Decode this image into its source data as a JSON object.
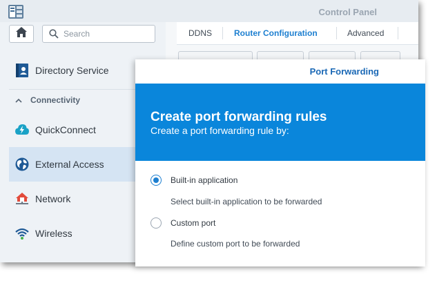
{
  "window": {
    "title": "Control Panel",
    "icon": "control-panel-icon"
  },
  "sidebar": {
    "home_icon": "home-icon",
    "search": {
      "placeholder": "Search",
      "value": ""
    },
    "items": [
      {
        "label": "Directory Service",
        "icon": "directory-service-icon"
      },
      {
        "label": "QuickConnect",
        "icon": "quickconnect-icon"
      },
      {
        "label": "External Access",
        "icon": "globe-icon",
        "active": true
      },
      {
        "label": "Network",
        "icon": "network-icon"
      },
      {
        "label": "Wireless",
        "icon": "wifi-icon"
      }
    ],
    "section": {
      "label": "Connectivity",
      "icon": "chevron-up-icon"
    }
  },
  "tabs": [
    {
      "label": "DDNS",
      "active": false
    },
    {
      "label": "Router Configuration",
      "active": true
    },
    {
      "label": "Advanced",
      "active": false
    }
  ],
  "dialog": {
    "title": "Port Forwarding",
    "banner_title": "Create port forwarding rules",
    "banner_subtitle": "Create a port forwarding rule by:",
    "options": [
      {
        "label": "Built-in application",
        "description": "Select built-in application to be forwarded",
        "selected": true
      },
      {
        "label": "Custom port",
        "description": "Define custom port to be forwarded",
        "selected": false
      }
    ]
  },
  "colors": {
    "accent": "#1d7fd0",
    "banner": "#0a86db",
    "active_nav": "#d5e4f3"
  }
}
